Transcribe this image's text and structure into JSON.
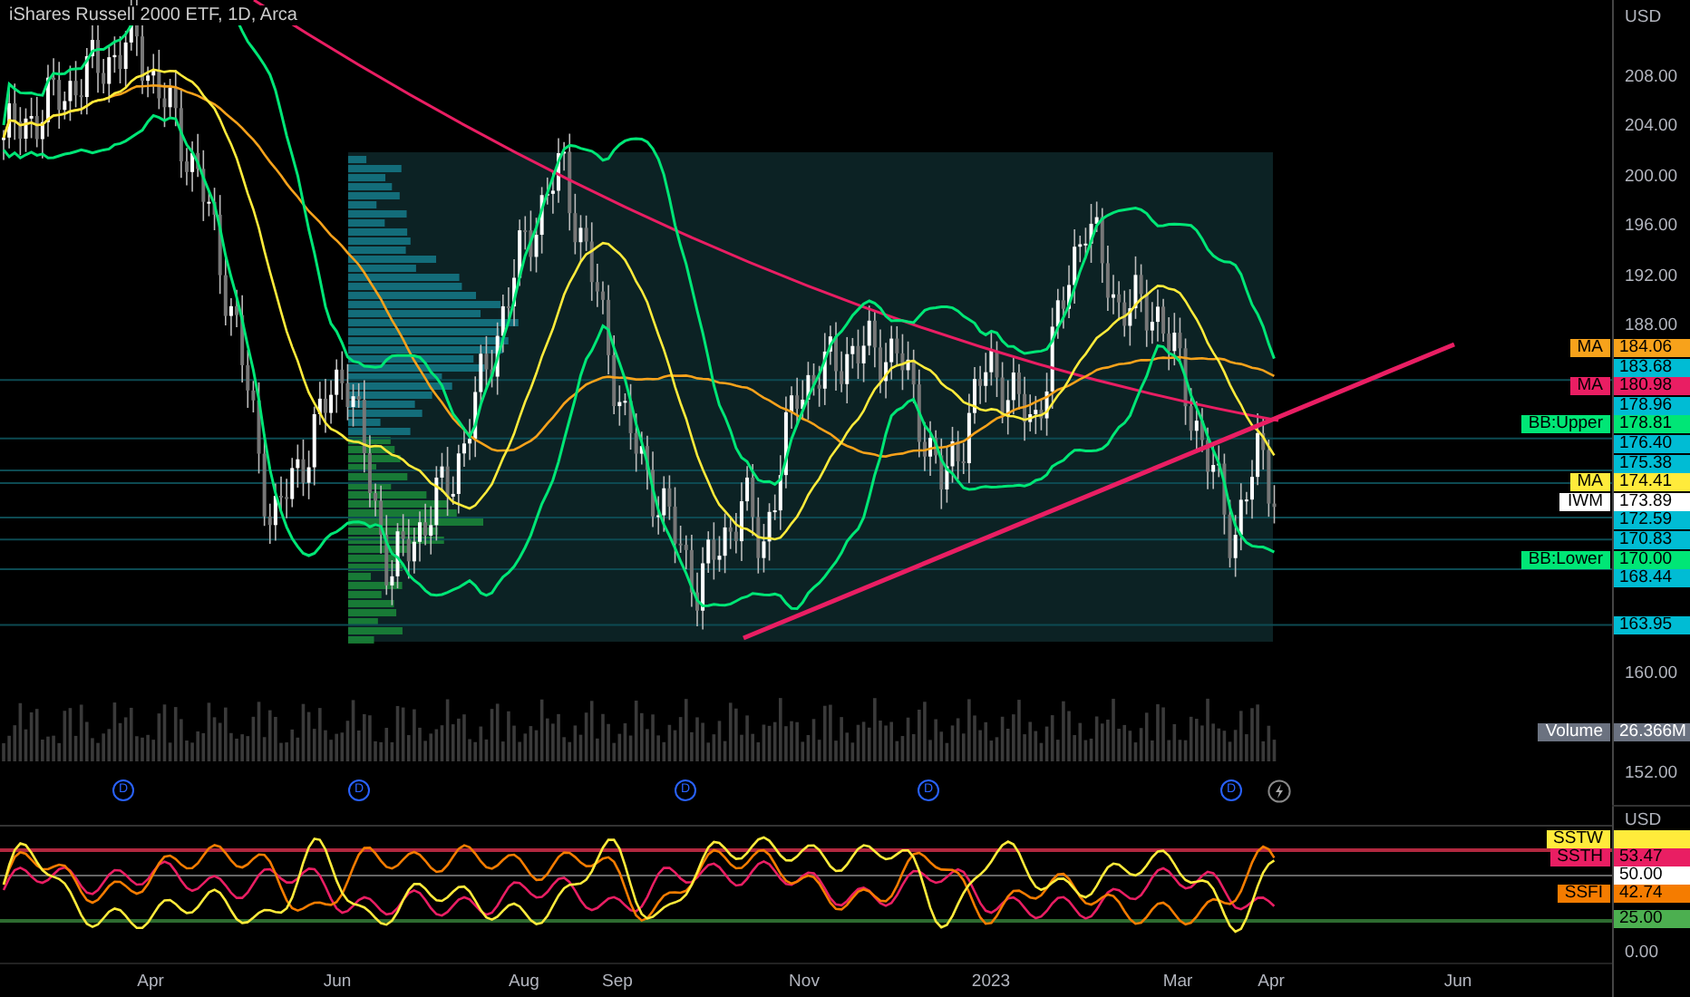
{
  "header": {
    "title": "iShares Russell 2000 ETF, 1D, Arca"
  },
  "price_axis": {
    "currency": "USD",
    "ticks": [
      "208.00",
      "204.00",
      "200.00",
      "196.00",
      "192.00",
      "188.00",
      "160.00",
      "152.00"
    ]
  },
  "price_labels": [
    {
      "label": "MA",
      "value": "184.06",
      "color": "#f7a21b"
    },
    {
      "value": "183.68",
      "color": "#00bcd4"
    },
    {
      "label": "MA",
      "value": "180.98",
      "color": "#e91e63"
    },
    {
      "value": "178.96",
      "color": "#00bcd4"
    },
    {
      "label": "BB:Upper",
      "value": "178.81",
      "color": "#00e676"
    },
    {
      "value": "176.40",
      "color": "#00bcd4"
    },
    {
      "value": "175.38",
      "color": "#00bcd4"
    },
    {
      "label": "MA",
      "value": "174.41",
      "color": "#ffeb3b"
    },
    {
      "label": "IWM",
      "value": "173.89",
      "color": "#ffffff"
    },
    {
      "value": "172.59",
      "color": "#00bcd4"
    },
    {
      "value": "170.83",
      "color": "#00bcd4"
    },
    {
      "label": "BB:Lower",
      "value": "170.00",
      "color": "#00e676"
    },
    {
      "value": "168.44",
      "color": "#00bcd4"
    },
    {
      "value": "163.95",
      "color": "#00bcd4"
    }
  ],
  "volume": {
    "label": "Volume",
    "value": "26.366M"
  },
  "dividend_markers": [
    "D",
    "D",
    "D",
    "D",
    "D"
  ],
  "oscillator": {
    "currency": "USD",
    "labels": [
      {
        "label": "SSTW",
        "color": "#ffeb3b"
      },
      {
        "label": "SSTH",
        "value": "53.47",
        "color": "#e91e63"
      },
      {
        "value": "50.00",
        "color": "#ffffff"
      },
      {
        "label": "SSFI",
        "value": "42.74",
        "color": "#f57c00"
      },
      {
        "value": "25.00",
        "color": "#4caf50"
      }
    ],
    "ticks": [
      "0.00"
    ]
  },
  "time_axis": [
    "Apr",
    "Jun",
    "Aug",
    "Sep",
    "Nov",
    "2023",
    "Mar",
    "Apr",
    "Jun"
  ]
}
